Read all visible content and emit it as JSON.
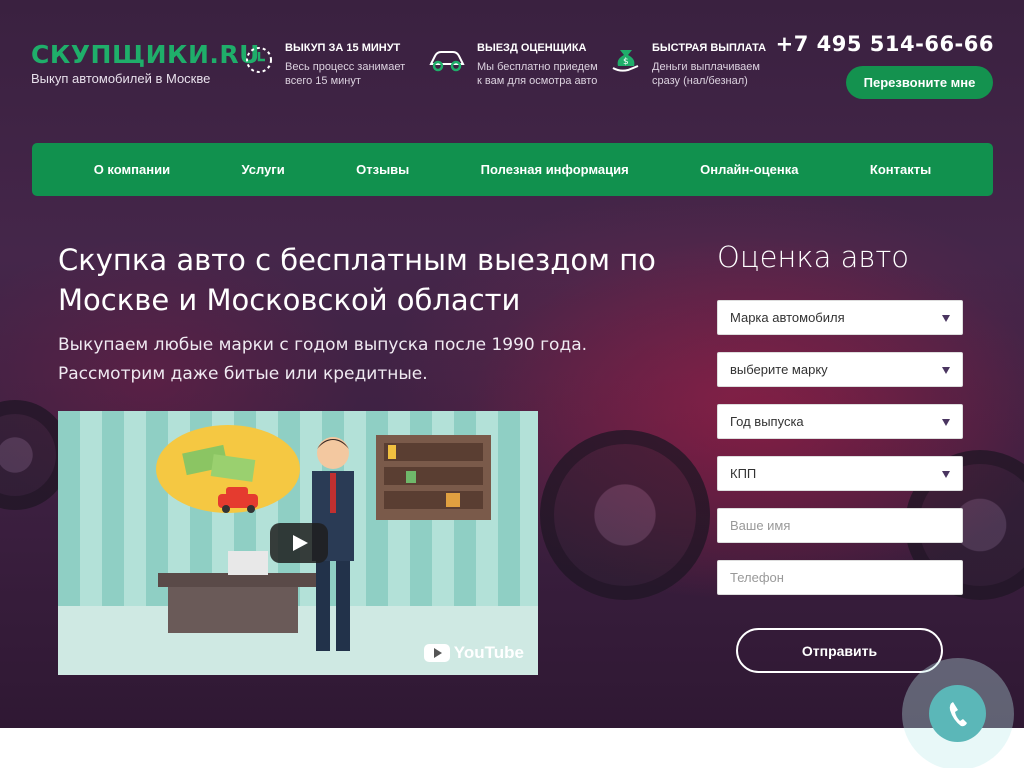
{
  "header": {
    "logo_title": "СКУПЩИКИ.RU",
    "logo_sub": "Выкуп автомобилей в Москве",
    "features": [
      {
        "icon": "clock-icon",
        "title": "ВЫКУП ЗА 15 МИНУТ",
        "line1": "Весь процесс занимает",
        "line2": "всего 15 минут"
      },
      {
        "icon": "car-icon",
        "title": "ВЫЕЗД ОЦЕНЩИКА",
        "line1": "Мы бесплатно приедем",
        "line2": "к вам для осмотра авто"
      },
      {
        "icon": "money-bag-icon",
        "title": "БЫСТРАЯ ВЫПЛАТА",
        "line1": "Деньги выплачиваем",
        "line2": "сразу (нал/безнал)"
      }
    ],
    "phone": "+7 495 514-66-66",
    "callback_label": "Перезвоните мне"
  },
  "nav": {
    "items": [
      "О компании",
      "Услуги",
      "Отзывы",
      "Полезная информация",
      "Онлайн-оценка",
      "Контакты"
    ]
  },
  "hero": {
    "title": "Скупка авто с бесплатным выездом по Москве и Московской области",
    "sub_line1": "Выкупаем любые марки с годом выпуска после 1990 года.",
    "sub_line2": "Рассмотрим даже битые или кредитные.",
    "video_brand": "YouTube"
  },
  "form": {
    "title": "Оценка авто",
    "selects": [
      "Марка автомобиля",
      "выберите марку",
      "Год выпуска",
      "КПП"
    ],
    "name_placeholder": "Ваше имя",
    "phone_placeholder": "Телефон",
    "submit_label": "Отправить"
  },
  "colors": {
    "brand_green": "#11914e",
    "logo_green": "#1fae6a",
    "call_teal": "#5bb7b8"
  }
}
